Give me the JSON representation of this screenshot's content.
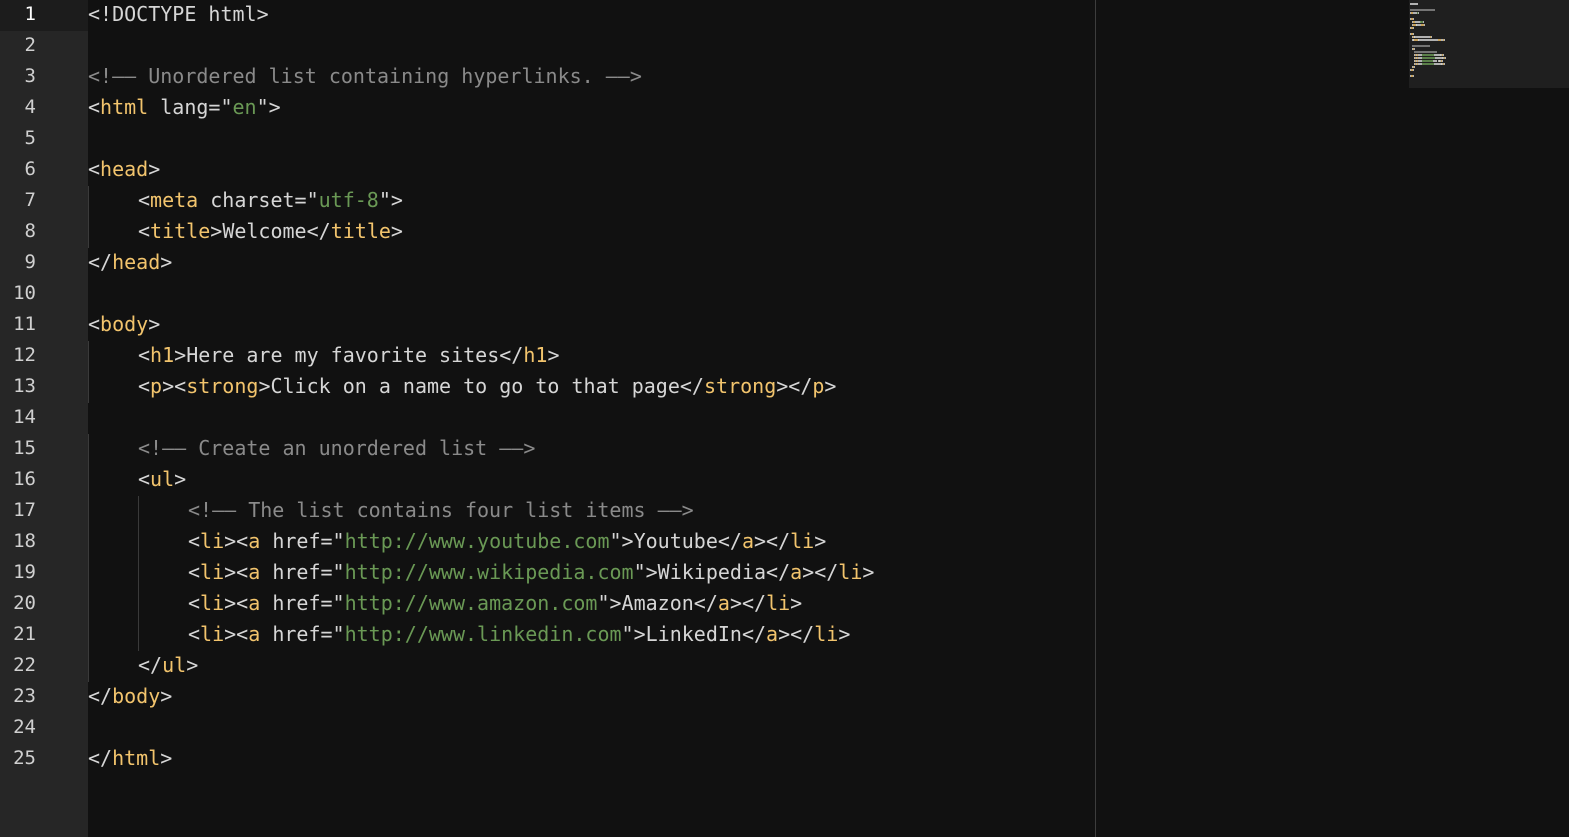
{
  "editor": {
    "active_line": 1,
    "line_numbers": [
      "1",
      "2",
      "3",
      "4",
      "5",
      "6",
      "7",
      "8",
      "9",
      "10",
      "11",
      "12",
      "13",
      "14",
      "15",
      "16",
      "17",
      "18",
      "19",
      "20",
      "21",
      "22",
      "23",
      "24",
      "25"
    ],
    "lines": [
      {
        "indent": 0,
        "tokens": [
          [
            "punc",
            "<!DOCTYPE html>"
          ]
        ]
      },
      {
        "indent": 0,
        "tokens": []
      },
      {
        "indent": 0,
        "tokens": [
          [
            "com",
            "<!—— Unordered list containing hyperlinks. ——>"
          ]
        ]
      },
      {
        "indent": 0,
        "tokens": [
          [
            "punc",
            "<"
          ],
          [
            "tag",
            "html"
          ],
          [
            "attr",
            " lang="
          ],
          [
            "punc",
            "\""
          ],
          [
            "str",
            "en"
          ],
          [
            "punc",
            "\">"
          ]
        ]
      },
      {
        "indent": 0,
        "tokens": []
      },
      {
        "indent": 0,
        "tokens": [
          [
            "punc",
            "<"
          ],
          [
            "tag",
            "head"
          ],
          [
            "punc",
            ">"
          ]
        ]
      },
      {
        "indent": 1,
        "tokens": [
          [
            "punc",
            "<"
          ],
          [
            "tag",
            "meta"
          ],
          [
            "attr",
            " charset="
          ],
          [
            "punc",
            "\""
          ],
          [
            "str",
            "utf-8"
          ],
          [
            "punc",
            "\">"
          ]
        ]
      },
      {
        "indent": 1,
        "tokens": [
          [
            "punc",
            "<"
          ],
          [
            "tag",
            "title"
          ],
          [
            "punc",
            ">"
          ],
          [
            "text",
            "Welcome"
          ],
          [
            "punc",
            "</"
          ],
          [
            "tag",
            "title"
          ],
          [
            "punc",
            ">"
          ]
        ]
      },
      {
        "indent": 0,
        "tokens": [
          [
            "punc",
            "</"
          ],
          [
            "tag",
            "head"
          ],
          [
            "punc",
            ">"
          ]
        ]
      },
      {
        "indent": 0,
        "tokens": []
      },
      {
        "indent": 0,
        "tokens": [
          [
            "punc",
            "<"
          ],
          [
            "tag",
            "body"
          ],
          [
            "punc",
            ">"
          ]
        ]
      },
      {
        "indent": 1,
        "tokens": [
          [
            "punc",
            "<"
          ],
          [
            "tag",
            "h1"
          ],
          [
            "punc",
            ">"
          ],
          [
            "text",
            "Here are my favorite sites"
          ],
          [
            "punc",
            "</"
          ],
          [
            "tag",
            "h1"
          ],
          [
            "punc",
            ">"
          ]
        ]
      },
      {
        "indent": 1,
        "tokens": [
          [
            "punc",
            "<"
          ],
          [
            "tag",
            "p"
          ],
          [
            "punc",
            "><"
          ],
          [
            "tag",
            "strong"
          ],
          [
            "punc",
            ">"
          ],
          [
            "text",
            "Click on a name to go to that page"
          ],
          [
            "punc",
            "</"
          ],
          [
            "tag",
            "strong"
          ],
          [
            "punc",
            "></"
          ],
          [
            "tag",
            "p"
          ],
          [
            "punc",
            ">"
          ]
        ]
      },
      {
        "indent": 0,
        "tokens": []
      },
      {
        "indent": 1,
        "tokens": [
          [
            "com",
            "<!—— Create an unordered list ——>"
          ]
        ]
      },
      {
        "indent": 1,
        "tokens": [
          [
            "punc",
            "<"
          ],
          [
            "tag",
            "ul"
          ],
          [
            "punc",
            ">"
          ]
        ]
      },
      {
        "indent": 2,
        "tokens": [
          [
            "com",
            "<!—— The list contains four list items ——>"
          ]
        ]
      },
      {
        "indent": 2,
        "tokens": [
          [
            "punc",
            "<"
          ],
          [
            "tag",
            "li"
          ],
          [
            "punc",
            "><"
          ],
          [
            "tag",
            "a"
          ],
          [
            "attr",
            " href="
          ],
          [
            "punc",
            "\""
          ],
          [
            "str",
            "http://www.youtube.com"
          ],
          [
            "punc",
            "\">"
          ],
          [
            "text",
            "Youtube"
          ],
          [
            "punc",
            "</"
          ],
          [
            "tag",
            "a"
          ],
          [
            "punc",
            "></"
          ],
          [
            "tag",
            "li"
          ],
          [
            "punc",
            ">"
          ]
        ]
      },
      {
        "indent": 2,
        "tokens": [
          [
            "punc",
            "<"
          ],
          [
            "tag",
            "li"
          ],
          [
            "punc",
            "><"
          ],
          [
            "tag",
            "a"
          ],
          [
            "attr",
            " href="
          ],
          [
            "punc",
            "\""
          ],
          [
            "str",
            "http://www.wikipedia.com"
          ],
          [
            "punc",
            "\">"
          ],
          [
            "text",
            "Wikipedia"
          ],
          [
            "punc",
            "</"
          ],
          [
            "tag",
            "a"
          ],
          [
            "punc",
            "></"
          ],
          [
            "tag",
            "li"
          ],
          [
            "punc",
            ">"
          ]
        ]
      },
      {
        "indent": 2,
        "tokens": [
          [
            "punc",
            "<"
          ],
          [
            "tag",
            "li"
          ],
          [
            "punc",
            "><"
          ],
          [
            "tag",
            "a"
          ],
          [
            "attr",
            " href="
          ],
          [
            "punc",
            "\""
          ],
          [
            "str",
            "http://www.amazon.com"
          ],
          [
            "punc",
            "\">"
          ],
          [
            "text",
            "Amazon"
          ],
          [
            "punc",
            "</"
          ],
          [
            "tag",
            "a"
          ],
          [
            "punc",
            "></"
          ],
          [
            "tag",
            "li"
          ],
          [
            "punc",
            ">"
          ]
        ]
      },
      {
        "indent": 2,
        "tokens": [
          [
            "punc",
            "<"
          ],
          [
            "tag",
            "li"
          ],
          [
            "punc",
            "><"
          ],
          [
            "tag",
            "a"
          ],
          [
            "attr",
            " href="
          ],
          [
            "punc",
            "\""
          ],
          [
            "str",
            "http://www.linkedin.com"
          ],
          [
            "punc",
            "\">"
          ],
          [
            "text",
            "LinkedIn"
          ],
          [
            "punc",
            "</"
          ],
          [
            "tag",
            "a"
          ],
          [
            "punc",
            "></"
          ],
          [
            "tag",
            "li"
          ],
          [
            "punc",
            ">"
          ]
        ]
      },
      {
        "indent": 1,
        "tokens": [
          [
            "punc",
            "</"
          ],
          [
            "tag",
            "ul"
          ],
          [
            "punc",
            ">"
          ]
        ]
      },
      {
        "indent": 0,
        "tokens": [
          [
            "punc",
            "</"
          ],
          [
            "tag",
            "body"
          ],
          [
            "punc",
            ">"
          ]
        ]
      },
      {
        "indent": 0,
        "tokens": []
      },
      {
        "indent": 0,
        "tokens": [
          [
            "punc",
            "</"
          ],
          [
            "tag",
            "html"
          ],
          [
            "punc",
            ">"
          ]
        ]
      }
    ]
  },
  "colors": {
    "background": "#111111",
    "gutter": "#262626",
    "tag": "#f2c46d",
    "string": "#6a9955",
    "comment": "#8a8a8a",
    "text": "#d6d6d6"
  }
}
